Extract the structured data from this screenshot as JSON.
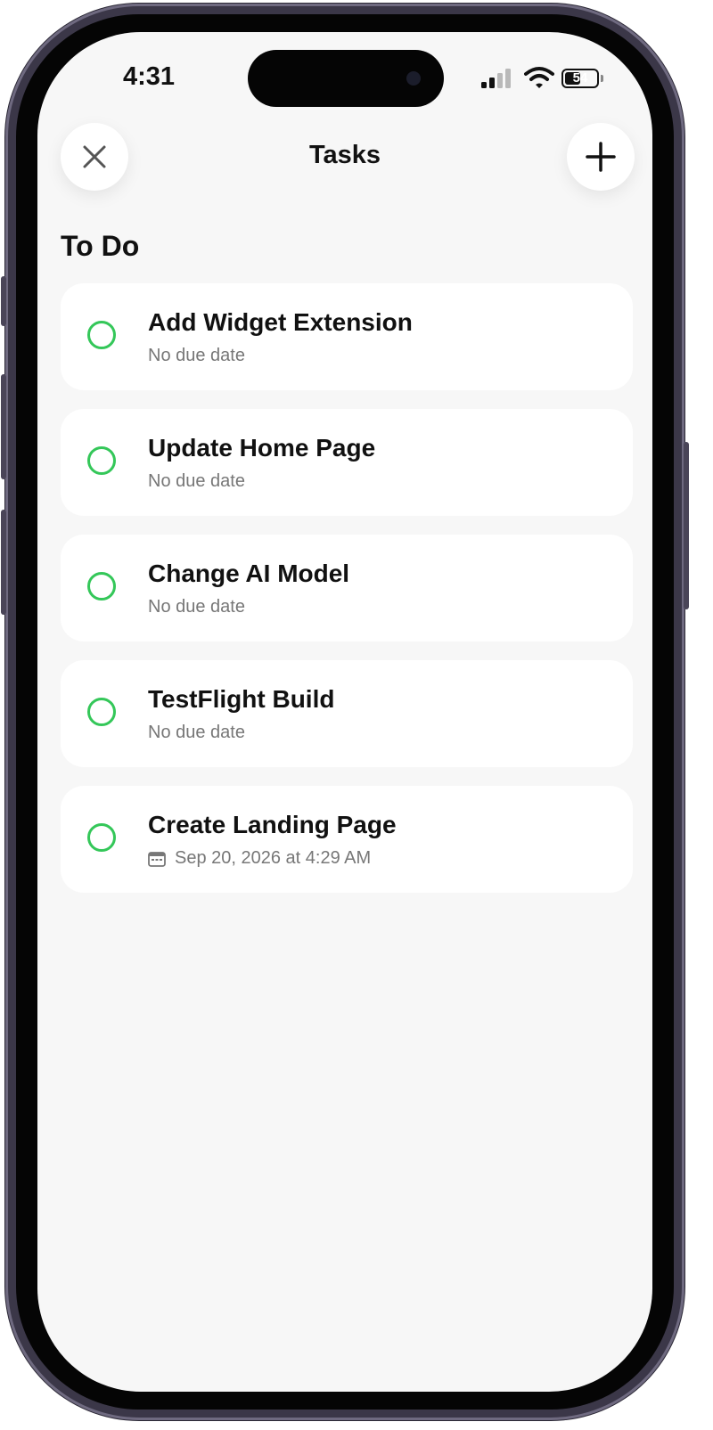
{
  "status_bar": {
    "time": "4:31",
    "battery": "54",
    "battery_level": 0.54
  },
  "nav": {
    "title": "Tasks",
    "close_icon": "close-icon",
    "add_icon": "plus-icon"
  },
  "section": {
    "title": "To Do"
  },
  "tasks": [
    {
      "title": "Add Widget Extension",
      "subtitle": "No due date",
      "has_date": false
    },
    {
      "title": "Update Home Page",
      "subtitle": "No due date",
      "has_date": false
    },
    {
      "title": "Change AI Model",
      "subtitle": "No due date",
      "has_date": false
    },
    {
      "title": "TestFlight Build",
      "subtitle": "No due date",
      "has_date": false
    },
    {
      "title": "Create Landing Page",
      "subtitle": "Sep 20, 2026 at 4:29 AM",
      "has_date": true
    }
  ],
  "colors": {
    "accent_green": "#34c759",
    "background": "#f7f7f7",
    "card": "#ffffff"
  }
}
